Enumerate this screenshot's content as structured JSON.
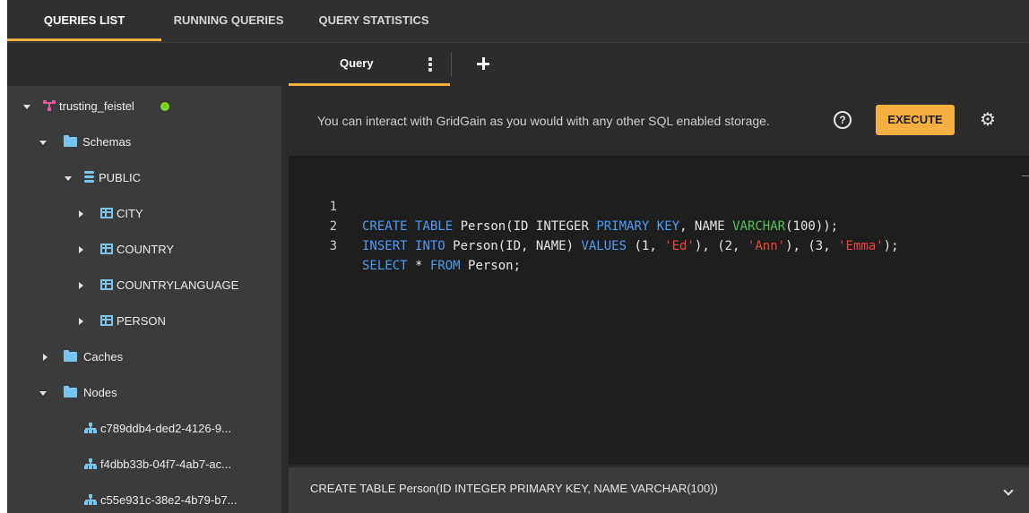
{
  "top_tabs": [
    {
      "label": "QUERIES LIST",
      "active": true
    },
    {
      "label": "RUNNING QUERIES",
      "active": false
    },
    {
      "label": "QUERY STATISTICS",
      "active": false
    }
  ],
  "query_tab": {
    "label": "Query"
  },
  "tree": {
    "cluster": {
      "label": "trusting_feistel",
      "status_color": "#7ed321"
    },
    "schemas": {
      "label": "Schemas",
      "public": {
        "label": "PUBLIC",
        "tables": [
          "CITY",
          "COUNTRY",
          "COUNTRYLANGUAGE",
          "PERSON"
        ]
      }
    },
    "caches": {
      "label": "Caches"
    },
    "nodes": {
      "label": "Nodes",
      "items": [
        "c789ddb4-ded2-4126-9...",
        "f4dbb33b-04f7-4ab7-ac...",
        "c55e931c-38e2-4b79-b7..."
      ]
    }
  },
  "info": {
    "text": "You can interact with GridGain as you would with any other SQL enabled storage.",
    "help_glyph": "?",
    "execute_label": "EXECUTE",
    "settings_glyph": "⚙"
  },
  "editor": {
    "lines": [
      {
        "num": "1",
        "text": "CREATE TABLE Person(ID INTEGER PRIMARY KEY, NAME VARCHAR(100));"
      },
      {
        "num": "2",
        "text": "INSERT INTO Person(ID, NAME) VALUES (1, 'Ed'), (2, 'Ann'), (3, 'Emma');"
      },
      {
        "num": "3",
        "text": "SELECT * FROM Person;"
      }
    ]
  },
  "result": {
    "text": "CREATE TABLE Person(ID INTEGER PRIMARY KEY, NAME VARCHAR(100))"
  },
  "colors": {
    "accent": "#f5b040",
    "keyword": "#4e9bf2",
    "string": "#f0443a",
    "function": "#4fc35a",
    "tree_icon": "#7cc4f0"
  }
}
